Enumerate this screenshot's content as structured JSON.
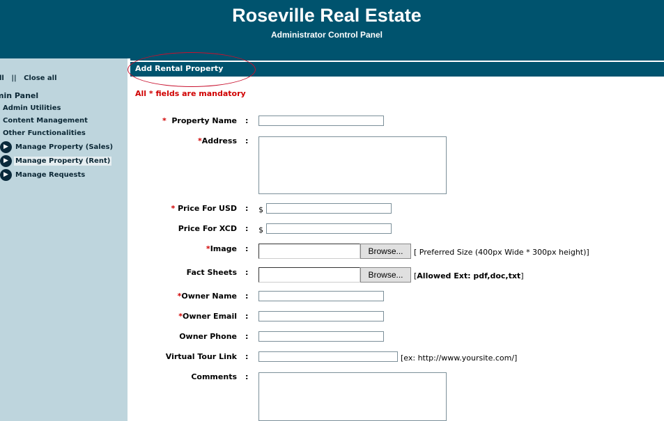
{
  "header": {
    "title": "Roseville Real Estate",
    "subtitle": "Administrator Control Panel"
  },
  "sidebar": {
    "toggle_left": "ll",
    "toggle_sep": "||",
    "close_all": "Close all",
    "panel_title": "min Panel",
    "categories": [
      "Admin Utilities",
      "Content Management",
      "Other Functionalities"
    ],
    "items": [
      "Manage Property (Sales)",
      "Manage Property (Rent)",
      "Manage Requests"
    ],
    "active_item": "Manage Property (Rent)"
  },
  "section": {
    "title": "Add Rental Property"
  },
  "form": {
    "mandatory_note": "All * fields are mandatory",
    "required_marker": "*",
    "colon": ":",
    "currency_symbol": "$",
    "fields": {
      "property_name": "Property Name",
      "address": "Address",
      "price_usd": "Price For USD",
      "price_xcd": "Price For XCD",
      "image": "Image",
      "fact_sheets": "Fact Sheets",
      "owner_name": "Owner Name",
      "owner_email": "Owner Email",
      "owner_phone": "Owner Phone",
      "virtual_tour": "Virtual Tour Link",
      "comments": "Comments"
    },
    "browse_label": "Browse...",
    "image_hint": "[ Preferred Size (400px Wide * 300px height)]",
    "fact_hint_open": "[",
    "fact_hint_bold": "Allowed Ext: pdf,doc,txt",
    "fact_hint_close": "]",
    "tour_hint": "[ex: http://www.yoursite.com/]"
  },
  "colors": {
    "header_bg": "#00536e",
    "sidebar_bg": "#bed5dd",
    "required": "#d00000",
    "highlight_ellipse": "#c8102e"
  },
  "icons": {
    "sidebar_item_bullet": "arrow-right-circle-icon"
  }
}
